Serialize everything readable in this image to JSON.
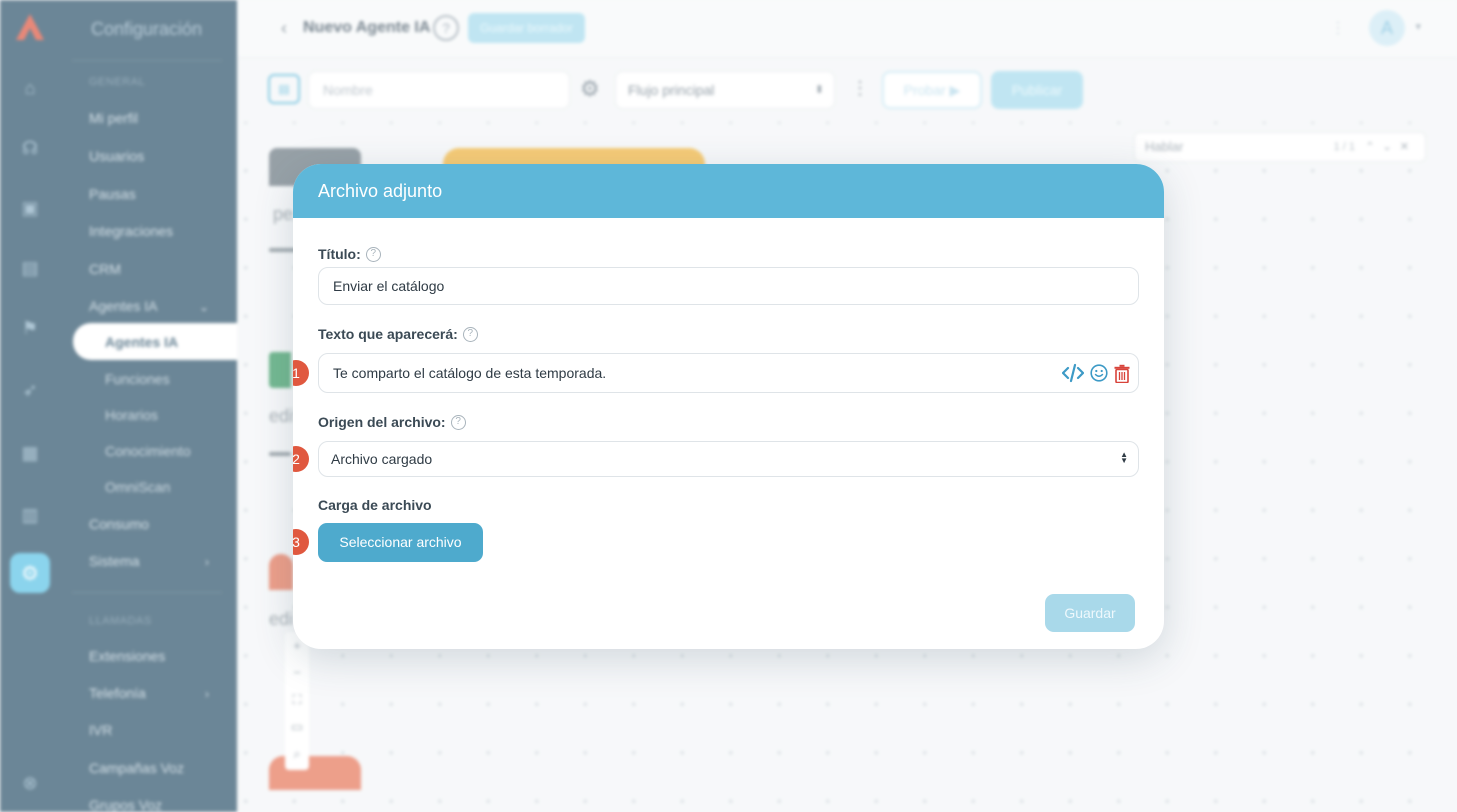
{
  "sidebar": {
    "title": "Configuración",
    "section_general": "GENERAL",
    "items": {
      "profile": "Mi perfil",
      "users": "Usuarios",
      "breaks": "Pausas",
      "integrations": "Integraciones",
      "crm": "CRM",
      "ai_agents": "Agentes IA",
      "consumption": "Consumo",
      "system": "Sistema"
    },
    "sub_items": {
      "ai_agents": "Agentes IA",
      "functions": "Funciones",
      "schedules": "Horarios",
      "knowledge": "Conocimiento",
      "omniscan": "OmniScan"
    },
    "section_calls": "LLAMADAS",
    "call_items": {
      "extensions": "Extensiones",
      "telephony": "Telefonía",
      "ivr": "IVR",
      "voice_campaigns": "Campañas Voz",
      "voice_groups": "Grupos Voz"
    }
  },
  "topbar": {
    "title": "Nuevo Agente IA",
    "help": "?",
    "status_badge": "Guardar borrador",
    "avatar_initial": "A"
  },
  "toolbar": {
    "name_placeholder": "Nombre",
    "flow_select": "Flujo principal",
    "test_label": "Probar",
    "publish_label": "Publicar"
  },
  "canvas": {
    "search_value": "Hablar",
    "search_count": "1 / 1",
    "fragments": [
      "pe",
      "edi",
      "edi"
    ]
  },
  "modal": {
    "title": "Archivo adjunto",
    "title_label": "Título:",
    "title_value": "Enviar el catálogo",
    "text_label": "Texto que aparecerá:",
    "text_value": "Te comparto el catálogo de esta temporada.",
    "origin_label": "Origen del archivo:",
    "origin_value": "Archivo cargado",
    "upload_label": "Carga de archivo",
    "select_file_label": "Seleccionar archivo",
    "save_label": "Guardar",
    "steps": [
      "1",
      "2",
      "3"
    ]
  },
  "colors": {
    "sidebar_bg": "#33586f",
    "modal_header": "#5eb7d9",
    "primary_button": "#4eaacd",
    "step_badge": "#e0583f",
    "delete_icon": "#d8433a"
  }
}
